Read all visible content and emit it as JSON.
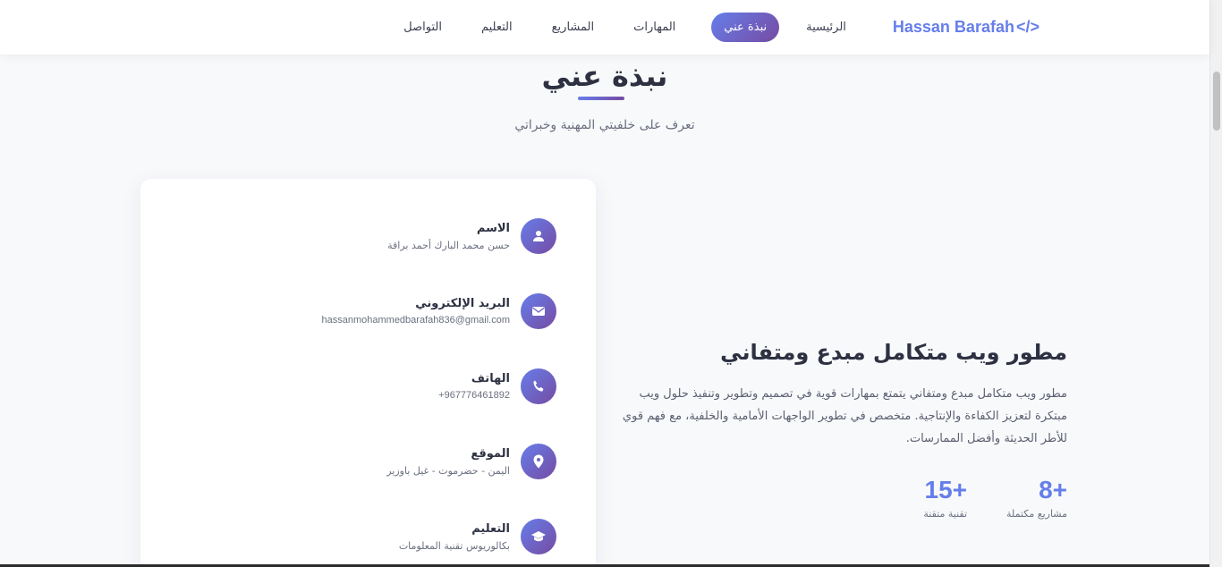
{
  "navbar": {
    "logo_text": "Hassan Barafah",
    "logo_icon": "</>",
    "links": [
      {
        "label": "الرئيسية"
      },
      {
        "label": "نبذة عني"
      },
      {
        "label": "المهارات"
      },
      {
        "label": "المشاريع"
      },
      {
        "label": "التعليم"
      },
      {
        "label": "التواصل"
      }
    ],
    "active_index": 1
  },
  "about": {
    "section_title": "نبذة عني",
    "section_subtitle": "تعرف على خلفيتي المهنية وخبراتي",
    "info": [
      {
        "label": "الاسم",
        "value": "حسن محمد البارك أحمد براقة",
        "icon": "user-icon"
      },
      {
        "label": "البريد الإلكتروني",
        "value": "hassanmohammedbarafah836@gmail.com",
        "icon": "envelope-icon"
      },
      {
        "label": "الهاتف",
        "value": "+967776461892",
        "icon": "phone-icon"
      },
      {
        "label": "الموقع",
        "value": "اليمن - حضرموت - غيل باوزير",
        "icon": "location-icon"
      },
      {
        "label": "التعليم",
        "value": "بكالوريوس تقنية المعلومات",
        "icon": "graduation-cap-icon"
      }
    ],
    "headline": "مطور ويب متكامل مبدع ومتفاني",
    "description": "مطور ويب متكامل مبدع ومتفاني يتمتع بمهارات قوية في تصميم وتطوير وتنفيذ حلول ويب مبتكرة لتعزيز الكفاءة والإنتاجية. متخصص في تطوير الواجهات الأمامية والخلفية، مع فهم قوي للأطر الحديثة وأفضل الممارسات.",
    "stats": [
      {
        "number": "+8",
        "label": "مشاريع مكتملة"
      },
      {
        "number": "+15",
        "label": "تقنية متقنة"
      }
    ]
  },
  "colors": {
    "accent": "#667eea",
    "accent_secondary": "#764ba2"
  }
}
